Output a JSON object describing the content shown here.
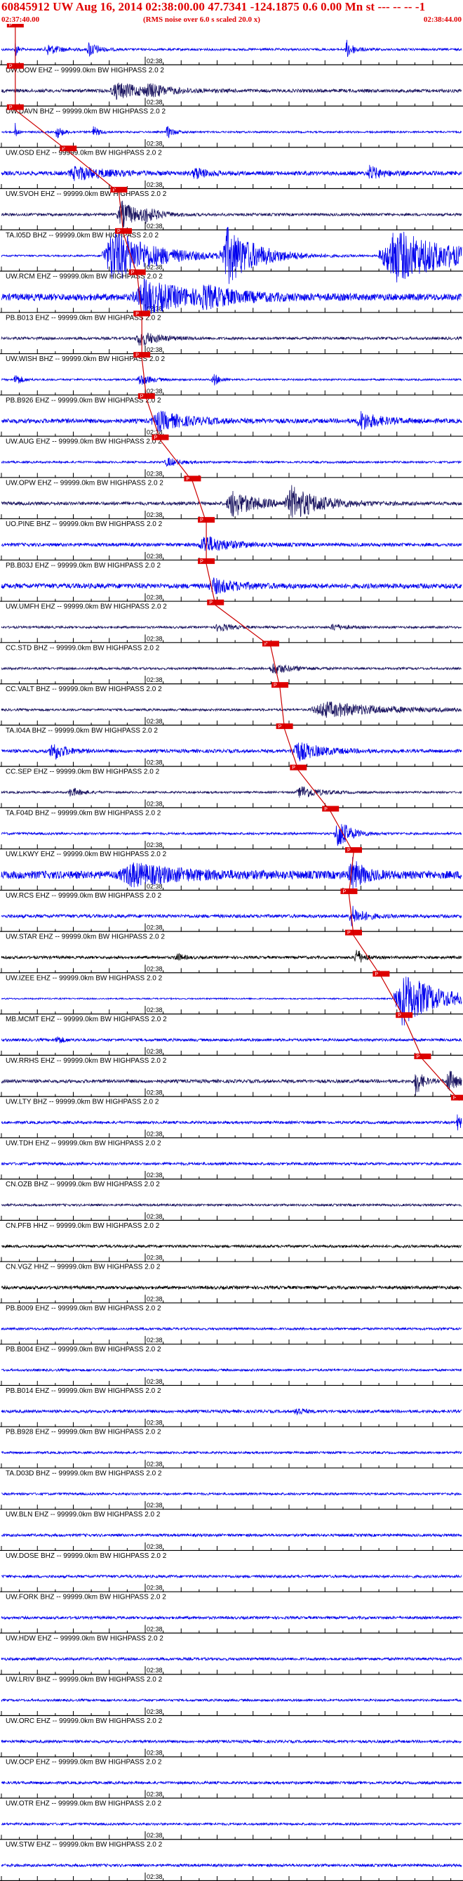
{
  "header": {
    "title": "60845912 UW Aug 16, 2014 02:38:00.00   47.7341 -124.1875  0.6 0.00 Mn st --- -- --  -1",
    "time_left": "02:37:40.00",
    "rms_note": "(RMS noise over 6.0 s scaled 20.0 x)",
    "time_right": "02:38:44.00"
  },
  "time_marker_label": "02:38",
  "pick_label": "P",
  "colors": {
    "header_red": "#e00000",
    "blue": "#0000ee",
    "navy": "#1a1460",
    "black": "#000000",
    "pick_box": "#dd0000",
    "pick_line": "#cc0000"
  },
  "traces": [
    {
      "label": "",
      "color": "blue",
      "pick": 0.015,
      "amp": 0.1,
      "events": [
        [
          0.03,
          0.004,
          0.9
        ],
        [
          0.1,
          0.02,
          0.5
        ],
        [
          0.19,
          0.015,
          0.7
        ],
        [
          0.75,
          0.012,
          0.8
        ]
      ]
    },
    {
      "label": "UW.OOW EHZ -- 99999.0km BW  HIGHPASS  2.0  2",
      "color": "navy",
      "pick": 0.015,
      "amp": 0.15,
      "events": [
        [
          0.25,
          0.05,
          0.7
        ],
        [
          0.32,
          0.03,
          0.4
        ]
      ]
    },
    {
      "label": "UW.DAVN BHZ -- 99999.0km BW  HIGHPASS  2.0  2",
      "color": "blue",
      "pick": 0.015,
      "amp": 0.08,
      "events": [
        [
          0.03,
          0.003,
          0.9
        ],
        [
          0.12,
          0.01,
          0.6
        ],
        [
          0.2,
          0.01,
          0.5
        ],
        [
          0.36,
          0.01,
          0.6
        ]
      ]
    },
    {
      "label": "UW.OSD EHZ -- 99999.0km BW  HIGHPASS  2.0  2",
      "color": "blue",
      "pick": 0.13,
      "amp": 0.18,
      "events": [
        [
          0.16,
          0.05,
          0.6
        ],
        [
          0.42,
          0.02,
          0.5
        ],
        [
          0.8,
          0.02,
          0.6
        ]
      ]
    },
    {
      "label": "UW.SVOH EHZ -- 99999.0km BW  HIGHPASS  2.0  2",
      "color": "navy",
      "pick": 0.24,
      "amp": 0.12,
      "events": [
        [
          0.26,
          0.03,
          1.2
        ],
        [
          0.31,
          0.02,
          0.5
        ]
      ]
    },
    {
      "label": "TA.I05D BHZ -- 99999.0km BW  HIGHPASS  2.0  2",
      "color": "blue",
      "pick": 0.25,
      "amp": 0.08,
      "events": [
        [
          0.24,
          0.07,
          2.5
        ],
        [
          0.49,
          0.05,
          2.5
        ],
        [
          0.85,
          0.1,
          2.5
        ]
      ]
    },
    {
      "label": "UW.RCM EHZ -- 99999.0km BW  HIGHPASS  2.0  2",
      "color": "blue",
      "pick": 0.28,
      "amp": 0.3,
      "events": [
        [
          0.31,
          0.08,
          1.4
        ],
        [
          0.44,
          0.05,
          0.6
        ]
      ]
    },
    {
      "label": "PB.B013 EHZ -- 99999.0km BW  HIGHPASS  2.0  2",
      "color": "navy",
      "pick": 0.29,
      "amp": 0.12,
      "events": [
        [
          0.3,
          0.03,
          0.7
        ]
      ]
    },
    {
      "label": "UW.WISH BHZ -- 99999.0km BW  HIGHPASS  2.0  2",
      "color": "blue",
      "pick": 0.29,
      "amp": 0.08,
      "events": [
        [
          0.03,
          0.01,
          0.6
        ],
        [
          0.3,
          0.02,
          0.5
        ],
        [
          0.46,
          0.01,
          0.6
        ]
      ]
    },
    {
      "label": "PB.B926 EHZ -- 99999.0km BW  HIGHPASS  2.0  2",
      "color": "blue",
      "pick": 0.3,
      "amp": 0.2,
      "events": [
        [
          0.34,
          0.05,
          0.8
        ],
        [
          0.78,
          0.03,
          0.8
        ]
      ]
    },
    {
      "label": "UW.AUG EHZ -- 99999.0km BW  HIGHPASS  2.0  2",
      "color": "blue",
      "pick": 0.33,
      "amp": 0.09,
      "events": [
        [
          0.36,
          0.02,
          0.4
        ]
      ]
    },
    {
      "label": "UW.OPW EHZ -- 99999.0km BW  HIGHPASS  2.0  2",
      "color": "navy",
      "pick": 0.4,
      "amp": 0.15,
      "events": [
        [
          0.5,
          0.04,
          1.2
        ],
        [
          0.63,
          0.05,
          1.4
        ]
      ]
    },
    {
      "label": "UO.PINE BHZ -- 99999.0km BW  HIGHPASS  2.0  2",
      "color": "blue",
      "pick": 0.43,
      "amp": 0.15,
      "events": [
        [
          0.44,
          0.04,
          0.8
        ]
      ]
    },
    {
      "label": "PB.B03J EHZ -- 99999.0km BW  HIGHPASS  2.0  2",
      "color": "blue",
      "pick": 0.43,
      "amp": 0.22,
      "events": [
        [
          0.46,
          0.04,
          0.6
        ]
      ]
    },
    {
      "label": "UW.UMFH EHZ -- 99999.0km BW  HIGHPASS  2.0  2",
      "color": "navy",
      "pick": 0.45,
      "amp": 0.1,
      "events": [
        [
          0.47,
          0.02,
          0.4
        ],
        [
          0.72,
          0.02,
          0.3
        ]
      ]
    },
    {
      "label": "CC.STD BHZ -- 99999.0km BW  HIGHPASS  2.0  2",
      "color": "navy",
      "pick": 0.57,
      "amp": 0.1,
      "events": [
        [
          0.59,
          0.03,
          0.5
        ]
      ]
    },
    {
      "label": "CC.VALT BHZ -- 99999.0km BW  HIGHPASS  2.0  2",
      "color": "navy",
      "pick": 0.59,
      "amp": 0.1,
      "events": [
        [
          0.7,
          0.1,
          0.7
        ]
      ]
    },
    {
      "label": "TA.I04A BHZ -- 99999.0km BW  HIGHPASS  2.0  2",
      "color": "blue",
      "pick": 0.6,
      "amp": 0.15,
      "events": [
        [
          0.11,
          0.02,
          0.9
        ],
        [
          0.64,
          0.04,
          0.9
        ]
      ]
    },
    {
      "label": "CC.SEP EHZ -- 99999.0km BW  HIGHPASS  2.0  2",
      "color": "navy",
      "pick": 0.63,
      "amp": 0.09,
      "events": [
        [
          0.15,
          0.02,
          0.4
        ],
        [
          0.65,
          0.03,
          0.6
        ]
      ]
    },
    {
      "label": "TA.F04D BHZ -- 99999.0km BW  HIGHPASS  2.0  2",
      "color": "blue",
      "pick": 0.7,
      "amp": 0.1,
      "events": [
        [
          0.73,
          0.02,
          1.5
        ]
      ]
    },
    {
      "label": "UW.LKWY EHZ -- 99999.0km BW  HIGHPASS  2.0  2",
      "color": "blue",
      "pick": 0.75,
      "amp": 0.35,
      "events": [
        [
          0.28,
          0.08,
          0.9
        ],
        [
          0.76,
          0.02,
          1.4
        ]
      ]
    },
    {
      "label": "UW.RCS EHZ -- 99999.0km BW  HIGHPASS  2.0  2",
      "color": "blue",
      "pick": 0.74,
      "amp": 0.15,
      "events": [
        [
          0.76,
          0.02,
          0.9
        ]
      ]
    },
    {
      "label": "UW.STAR EHZ -- 99999.0km BW  HIGHPASS  2.0  2",
      "color": "black",
      "pick": 0.75,
      "amp": 0.12,
      "events": [
        [
          0.38,
          0.01,
          0.4
        ],
        [
          0.77,
          0.01,
          0.9
        ]
      ]
    },
    {
      "label": "UW.IZEE EHZ -- 99999.0km BW  HIGHPASS  2.0  2",
      "color": "blue",
      "pick": 0.81,
      "amp": 0.06,
      "events": [
        [
          0.87,
          0.06,
          2.5
        ]
      ]
    },
    {
      "label": "MB.MCMT EHZ -- 99999.0km BW  HIGHPASS  2.0  2",
      "color": "blue",
      "pick": 0.86,
      "amp": 0.12,
      "events": [
        [
          0.12,
          0.01,
          0.4
        ]
      ]
    },
    {
      "label": "UW.RRHS EHZ -- 99999.0km BW  HIGHPASS  2.0  2",
      "color": "navy",
      "pick": 0.9,
      "amp": 0.15,
      "events": [
        [
          0.9,
          0.01,
          1.4
        ],
        [
          0.97,
          0.015,
          1.1
        ]
      ]
    },
    {
      "label": "UW.LTY BHZ -- 99999.0km BW  HIGHPASS  2.0  2",
      "color": "blue",
      "pick": 0.98,
      "amp": 0.12,
      "events": [
        [
          0.99,
          0.01,
          0.7
        ]
      ]
    },
    {
      "label": "UW.TDH EHZ -- 99999.0km BW  HIGHPASS  2.0  2",
      "color": "blue",
      "pick": null,
      "amp": 0.12,
      "events": []
    },
    {
      "label": "CN.OZB BHZ -- 99999.0km BW  HIGHPASS  2.0  2",
      "color": "navy",
      "pick": null,
      "amp": 0.1,
      "events": []
    },
    {
      "label": "CN.PFB HHZ -- 99999.0km BW  HIGHPASS  2.0  2",
      "color": "black",
      "pick": null,
      "amp": 0.12,
      "events": []
    },
    {
      "label": "CN.VGZ HHZ -- 99999.0km BW  HIGHPASS  2.0  2",
      "color": "black",
      "pick": null,
      "amp": 0.14,
      "events": []
    },
    {
      "label": "PB.B009 EHZ -- 99999.0km BW  HIGHPASS  2.0  2",
      "color": "blue",
      "pick": null,
      "amp": 0.1,
      "events": []
    },
    {
      "label": "PB.B004 EHZ -- 99999.0km BW  HIGHPASS  2.0  2",
      "color": "blue",
      "pick": null,
      "amp": 0.1,
      "events": []
    },
    {
      "label": "PB.B014 EHZ -- 99999.0km BW  HIGHPASS  2.0  2",
      "color": "blue",
      "pick": null,
      "amp": 0.13,
      "events": [
        [
          0.64,
          0.01,
          0.5
        ]
      ]
    },
    {
      "label": "PB.B928 EHZ -- 99999.0km BW  HIGHPASS  2.0  2",
      "color": "blue",
      "pick": null,
      "amp": 0.1,
      "events": []
    },
    {
      "label": "TA.D03D BHZ -- 99999.0km BW  HIGHPASS  2.0  2",
      "color": "blue",
      "pick": null,
      "amp": 0.1,
      "events": []
    },
    {
      "label": "UW.BLN EHZ -- 99999.0km BW  HIGHPASS  2.0  2",
      "color": "blue",
      "pick": null,
      "amp": 0.12,
      "events": []
    },
    {
      "label": "UW.DOSE BHZ -- 99999.0km BW  HIGHPASS  2.0  2",
      "color": "blue",
      "pick": null,
      "amp": 0.12,
      "events": []
    },
    {
      "label": "UW.FORK BHZ -- 99999.0km BW  HIGHPASS  2.0  2",
      "color": "blue",
      "pick": null,
      "amp": 0.12,
      "events": []
    },
    {
      "label": "UW.HDW EHZ -- 99999.0km BW  HIGHPASS  2.0  2",
      "color": "blue",
      "pick": null,
      "amp": 0.12,
      "events": []
    },
    {
      "label": "UW.LRIV BHZ -- 99999.0km BW  HIGHPASS  2.0  2",
      "color": "blue",
      "pick": null,
      "amp": 0.1,
      "events": []
    },
    {
      "label": "UW.ORC EHZ -- 99999.0km BW  HIGHPASS  2.0  2",
      "color": "blue",
      "pick": null,
      "amp": 0.12,
      "events": []
    },
    {
      "label": "UW.OCP EHZ -- 99999.0km BW  HIGHPASS  2.0  2",
      "color": "blue",
      "pick": null,
      "amp": 0.12,
      "events": []
    },
    {
      "label": "UW.OTR EHZ -- 99999.0km BW  HIGHPASS  2.0  2",
      "color": "blue",
      "pick": null,
      "amp": 0.1,
      "events": []
    },
    {
      "label": "UW.STW EHZ -- 99999.0km BW  HIGHPASS  2.0  2",
      "color": "blue",
      "pick": null,
      "amp": 0.12,
      "events": []
    }
  ]
}
